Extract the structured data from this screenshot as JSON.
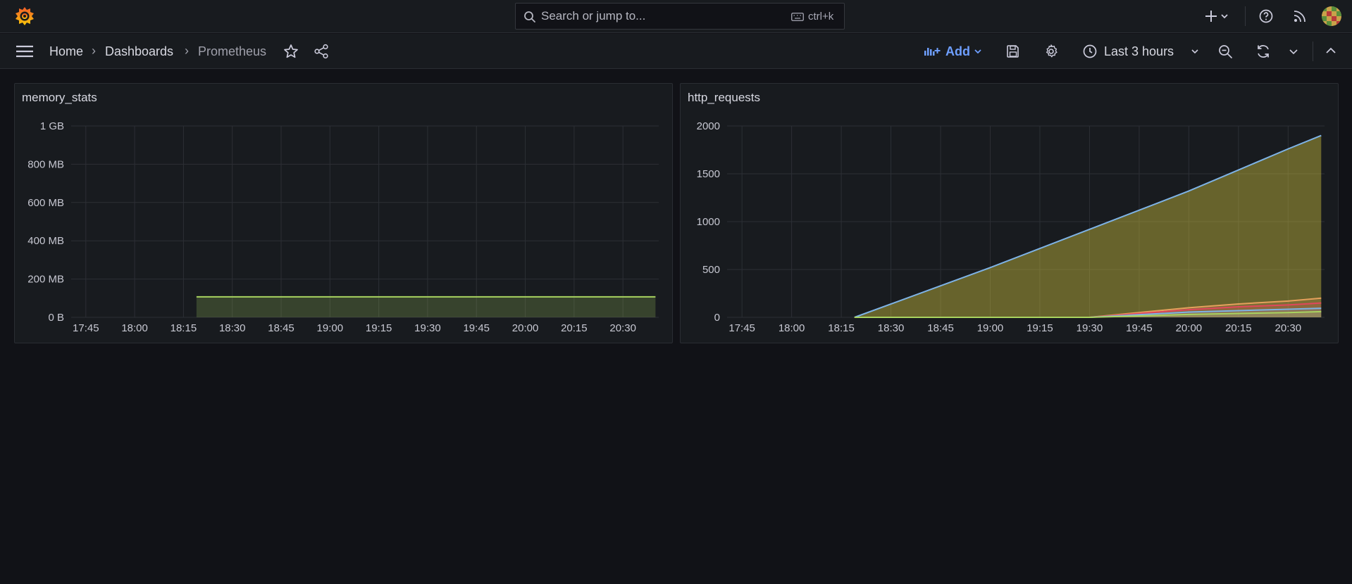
{
  "topbar": {
    "search_placeholder": "Search or jump to...",
    "shortcut": "ctrl+k"
  },
  "breadcrumb": {
    "home": "Home",
    "dashboards": "Dashboards",
    "current": "Prometheus"
  },
  "toolbar": {
    "add_label": "Add",
    "time_range": "Last 3 hours"
  },
  "colors": {
    "accent": "#6e9fff",
    "series_green": "#a8d35f",
    "series_yellow": "#d7c73d",
    "series_blue": "#7eb3e6",
    "series_red": "#e0475c",
    "series_orange": "#e5a05c"
  },
  "panels": [
    {
      "title": "memory_stats",
      "chart_data": {
        "type": "area",
        "x": [
          "18:19",
          "20:40"
        ],
        "series": [
          {
            "values": [
              107,
              107
            ]
          }
        ],
        "y_unit": "MB",
        "ylim": [
          0,
          1000
        ],
        "y_ticks": [
          "0 B",
          "200 MB",
          "400 MB",
          "600 MB",
          "800 MB",
          "1 GB"
        ],
        "x_ticks": [
          "17:45",
          "18:00",
          "18:15",
          "18:30",
          "18:45",
          "19:00",
          "19:15",
          "19:30",
          "19:45",
          "20:00",
          "20:15",
          "20:30"
        ],
        "grid": true
      }
    },
    {
      "title": "http_requests",
      "chart_data": {
        "type": "area",
        "x": [
          "18:19",
          "19:00",
          "19:30",
          "20:00",
          "20:15",
          "20:30",
          "20:40"
        ],
        "series": [
          {
            "values": [
              0,
              520,
              920,
              1320,
              1540,
              1760,
              1900
            ]
          },
          {
            "values": [
              0,
              0,
              0,
              100,
              140,
              170,
              200
            ]
          },
          {
            "values": [
              0,
              0,
              0,
              80,
              110,
              130,
              150
            ]
          },
          {
            "values": [
              0,
              0,
              0,
              55,
              70,
              85,
              95
            ]
          },
          {
            "values": [
              0,
              0,
              0,
              30,
              40,
              50,
              60
            ]
          }
        ],
        "ylim": [
          0,
          2000
        ],
        "y_ticks": [
          "0",
          "500",
          "1000",
          "1500",
          "2000"
        ],
        "x_ticks": [
          "17:45",
          "18:00",
          "18:15",
          "18:30",
          "18:45",
          "19:00",
          "19:15",
          "19:30",
          "19:45",
          "20:00",
          "20:15",
          "20:30"
        ],
        "grid": true
      }
    }
  ]
}
